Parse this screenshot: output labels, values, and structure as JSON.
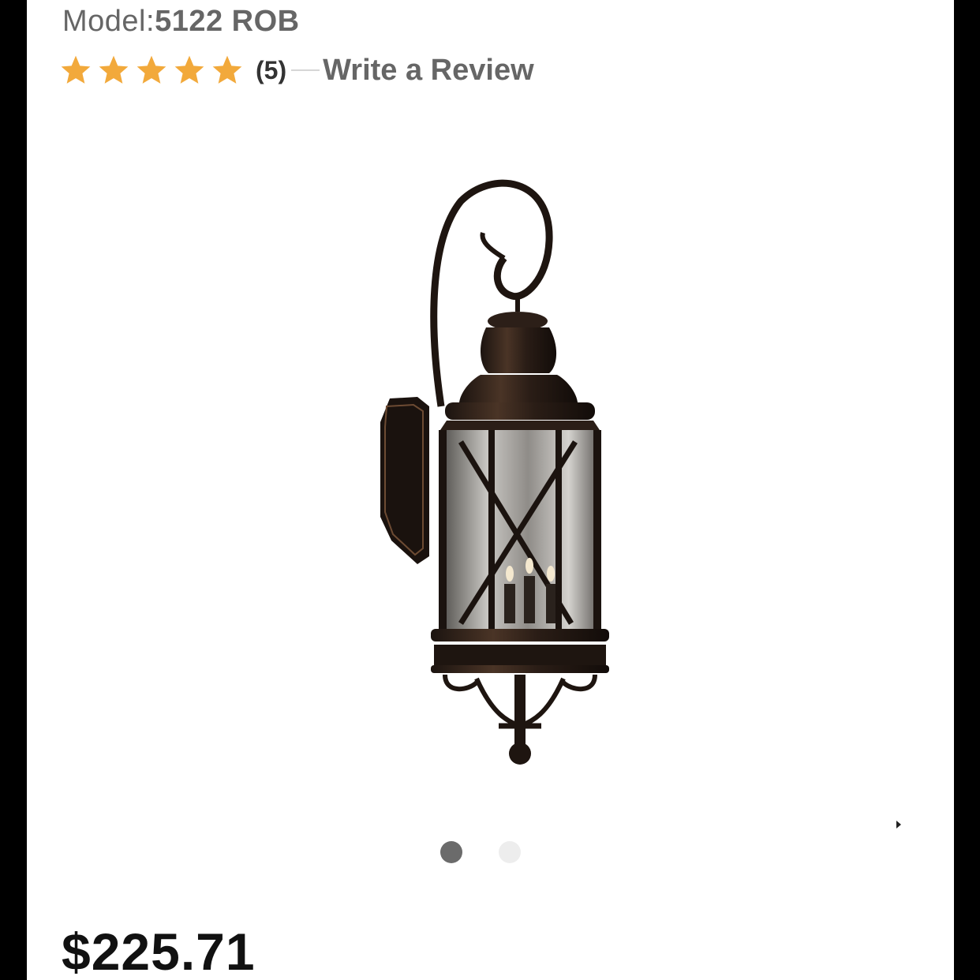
{
  "product": {
    "model_label": "Model:",
    "model_number": "5122 ROB",
    "rating": {
      "stars": 5,
      "max_stars": 5,
      "review_count": "(5)",
      "write_review_label": "Write a Review",
      "star_color": "#f2a93b"
    },
    "image": {
      "description_icon": "lantern-image",
      "slide_count": 2,
      "active_slide": 1
    },
    "price": "$225.71"
  }
}
